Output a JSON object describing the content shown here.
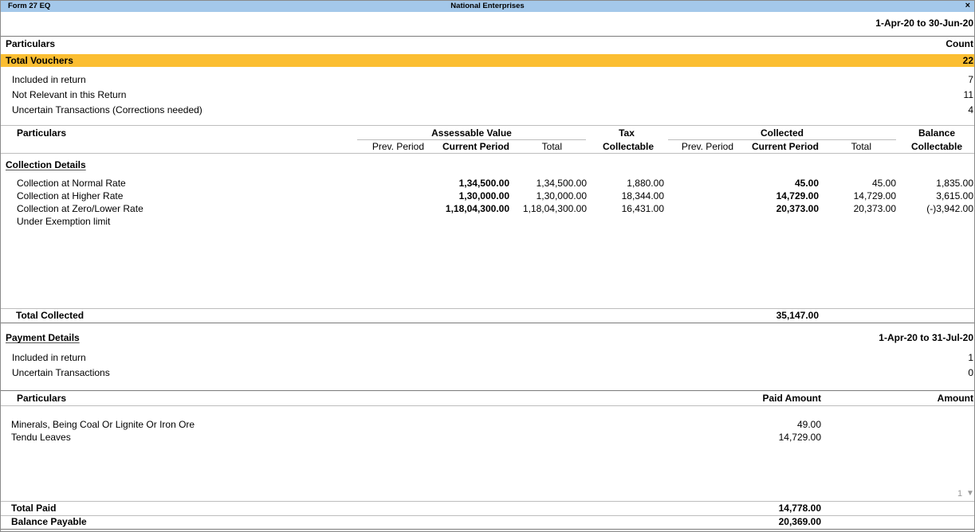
{
  "titlebar": {
    "form": "Form 27 EQ",
    "company": "National Enterprises",
    "close": "×"
  },
  "period": "1-Apr-20 to 30-Jun-20",
  "summary": {
    "col_particulars": "Particulars",
    "col_count": "Count",
    "total_vouchers": {
      "label": "Total Vouchers",
      "count": "22"
    },
    "rows": [
      {
        "label": "Included in return",
        "count": "7"
      },
      {
        "label": "Not Relevant in this Return",
        "count": "11"
      },
      {
        "label": "Uncertain Transactions (Corrections needed)",
        "count": "4"
      }
    ]
  },
  "collection_header": {
    "particulars": "Particulars",
    "assessable_value": "Assessable Value",
    "av_prev": "Prev. Period",
    "av_current": "Current Period",
    "av_total": "Total",
    "tax_top": "Tax",
    "tax_bottom": "Collectable",
    "collected": "Collected",
    "col_prev": "Prev. Period",
    "col_current": "Current Period",
    "col_total": "Total",
    "balance_top": "Balance",
    "balance_bottom": "Collectable"
  },
  "collection": {
    "title": "Collection Details",
    "rows": [
      {
        "label": "Collection at Normal Rate",
        "av_current": "1,34,500.00",
        "av_total": "1,34,500.00",
        "tax": "1,880.00",
        "col_current": "45.00",
        "col_total": "45.00",
        "balance": "1,835.00"
      },
      {
        "label": "Collection at Higher Rate",
        "av_current": "1,30,000.00",
        "av_total": "1,30,000.00",
        "tax": "18,344.00",
        "col_current": "14,729.00",
        "col_total": "14,729.00",
        "balance": "3,615.00"
      },
      {
        "label": "Collection at Zero/Lower Rate",
        "av_current": "1,18,04,300.00",
        "av_total": "1,18,04,300.00",
        "tax": "16,431.00",
        "col_current": "20,373.00",
        "col_total": "20,373.00",
        "balance": "(-)3,942.00"
      },
      {
        "label": "Under Exemption limit",
        "av_current": "",
        "av_total": "",
        "tax": "",
        "col_current": "",
        "col_total": "",
        "balance": ""
      }
    ],
    "total_label": "Total Collected",
    "total_value": "35,147.00"
  },
  "payment": {
    "title": "Payment Details",
    "period": "1-Apr-20 to 31-Jul-20",
    "rows": [
      {
        "label": "Included in return",
        "count": "1"
      },
      {
        "label": "Uncertain Transactions",
        "count": "0"
      }
    ]
  },
  "paid_header": {
    "particulars": "Particulars",
    "paid_amount": "Paid Amount",
    "amount": "Amount"
  },
  "paid_rows": [
    {
      "label": "Minerals, Being Coal Or Lignite Or Iron Ore",
      "paid": "49.00"
    },
    {
      "label": "Tendu Leaves",
      "paid": "14,729.00"
    }
  ],
  "page_indicator": "1",
  "scroll_down": "▼",
  "totals": {
    "total_paid_label": "Total Paid",
    "total_paid": "14,778.00",
    "balance_payable_label": "Balance Payable",
    "balance_payable": "20,369.00"
  }
}
